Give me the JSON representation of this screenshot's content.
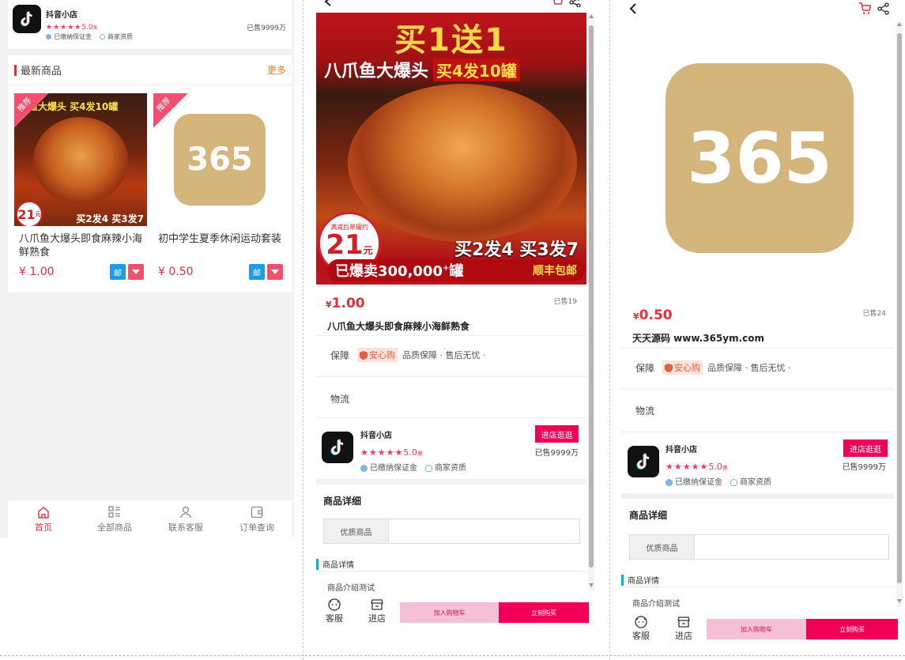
{
  "shop": {
    "name": "抖音小店",
    "stars": "★★★★★",
    "score": "5.0",
    "score_unit": "美",
    "sold": "已售9999万",
    "badge_deposit": "已缴纳保证金",
    "badge_qualification": "商家资质",
    "enter_button": "进店逛逛"
  },
  "home": {
    "section_title": "最新商品",
    "more_link": "更多",
    "products": [
      {
        "name": "八爪鱼大爆头即食麻辣小海鲜熟食",
        "price": "¥ 1.00",
        "tag": "推荐",
        "ship_badge": "邮",
        "img_banner": "鱼大爆头 买4发10罐",
        "img_price": "21",
        "img_price_unit": "元",
        "img_bottom": "买2发4 买3发7"
      },
      {
        "name": "初中学生夏季休闲运动套装",
        "price": "¥ 0.50",
        "tag": "推荐",
        "ship_badge": "邮",
        "logo_text": "365"
      }
    ],
    "tabs": [
      {
        "label": "首页",
        "icon": "home-icon"
      },
      {
        "label": "全部商品",
        "icon": "grid-list-icon"
      },
      {
        "label": "联系客服",
        "icon": "user-icon"
      },
      {
        "label": "订单查询",
        "icon": "wallet-icon"
      }
    ],
    "active_tab": 0
  },
  "detail1": {
    "img_title": "买1送1",
    "img_subtitle": "八爪鱼大爆头",
    "img_promo": "买4发10罐",
    "img_price_label": "满减后单罐约",
    "img_price": "21",
    "img_price_unit": "元",
    "img_deal": "买2发4 买3发7",
    "img_sold": "已爆卖300,000",
    "img_sold_plus": "+",
    "img_sold_unit": "罐",
    "img_shipping": "顺丰包邮",
    "price_symbol": "¥",
    "price": "1.00",
    "sold": "已售19",
    "title": "八爪鱼大爆头即食麻辣小海鲜熟食"
  },
  "detail2": {
    "logo_text": "365",
    "price_symbol": "¥",
    "price": "0.50",
    "sold": "已售24",
    "title": "天天源码 www.365ym.com"
  },
  "common": {
    "guarantee_label": "保障",
    "guarantee_badge": "安心购",
    "guarantee_text": "品质保障 · 售后无忧 ·",
    "logistics_label": "物流",
    "detail_heading": "商品详细",
    "table_key": "优质商品",
    "table_value": "",
    "detail_section": "商品详情",
    "detail_intro": "商品介绍测试",
    "service_label": "客服",
    "store_label": "进店",
    "add_cart": "加入购物车",
    "buy_now": "立刻购买"
  },
  "colors": {
    "accent": "#e0303e",
    "buy": "#f00056",
    "cart": "#f5bfd6",
    "logo": "#d4b67c",
    "teal": "#00b5c8"
  }
}
